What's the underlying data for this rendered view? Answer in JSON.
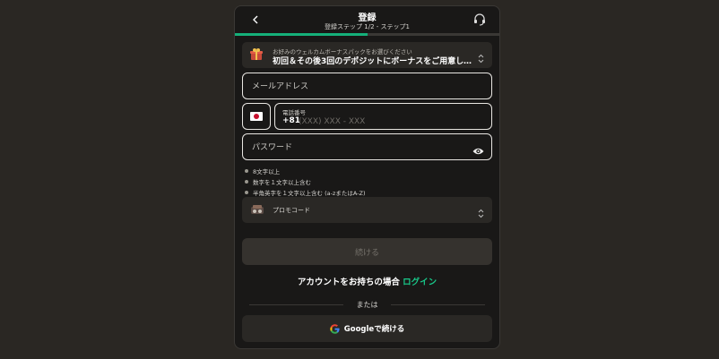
{
  "header": {
    "title": "登録",
    "subtitle": "登録ステップ 1/2 - ステップ1",
    "progress": 0.5
  },
  "bonus": {
    "label": "お好みのウェルカムボーナスパックをお選びください",
    "value": "初回＆その後3回のデポジットにボーナスをご用意してい..."
  },
  "email": {
    "placeholder": "メールアドレス"
  },
  "phone": {
    "label": "電話番号",
    "code": "+81",
    "placeholder": "(XXX) XXX - XXX"
  },
  "password": {
    "placeholder": "パスワード"
  },
  "rules": [
    "8文字以上",
    "数字を１文字以上含む",
    "半角英字を１文字以上含む (a-zまたはA-Z)"
  ],
  "promo": {
    "label": "プロモコード"
  },
  "continue_label": "続ける",
  "account": {
    "text": "アカウントをお持ちの場合",
    "login": "ログイン"
  },
  "or_label": "または",
  "google_label": "Googleで続ける",
  "colors": {
    "accent": "#19c98a",
    "background": "#191817",
    "card": "#2a2825"
  }
}
